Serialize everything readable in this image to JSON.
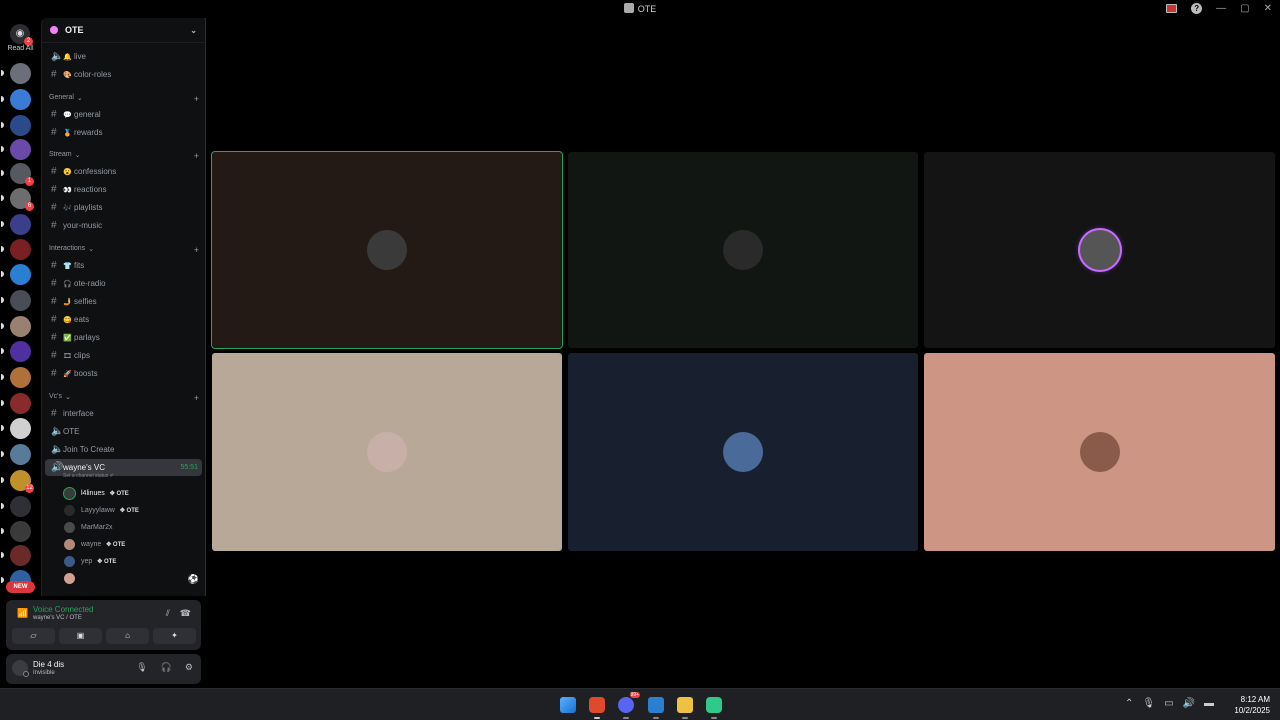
{
  "window": {
    "title": "OTE"
  },
  "rail": {
    "home_badge": "2",
    "read_all_label": "Read All",
    "new_label": "NEW",
    "servers": [
      {
        "color": "#6b6f7a",
        "badge": ""
      },
      {
        "color": "#3a7bd5",
        "badge": ""
      },
      {
        "color": "#2a4a8c",
        "badge": ""
      },
      {
        "color": "#6a4aa8",
        "badge": ""
      },
      {
        "color": "#555a60",
        "badge": "1"
      },
      {
        "color": "#6d6d70",
        "badge": "6"
      },
      {
        "color": "#3b3f8a",
        "badge": ""
      },
      {
        "color": "#7a1f24",
        "badge": ""
      },
      {
        "color": "#2a7fd0",
        "badge": ""
      },
      {
        "color": "#4a4d55",
        "badge": ""
      },
      {
        "color": "#9a8070",
        "badge": ""
      },
      {
        "color": "#5030a0",
        "badge": ""
      },
      {
        "color": "#b0703a",
        "badge": ""
      },
      {
        "color": "#8a2b2b",
        "badge": ""
      },
      {
        "color": "#d0d0d0",
        "badge": ""
      },
      {
        "color": "#5a7a9a",
        "badge": ""
      },
      {
        "color": "#c0902a",
        "badge": "12"
      },
      {
        "color": "#2e3035",
        "badge": ""
      },
      {
        "color": "#3a3a3a",
        "badge": ""
      },
      {
        "color": "#6a2a2a",
        "badge": ""
      },
      {
        "color": "#3060a0",
        "badge": ""
      }
    ]
  },
  "guild": {
    "name": "OTE"
  },
  "channels": [
    {
      "type": "voice",
      "emoji": "🔔",
      "name": "live"
    },
    {
      "type": "text",
      "emoji": "🎨",
      "name": "color-roles"
    },
    {
      "type": "category",
      "name": "General"
    },
    {
      "type": "text",
      "emoji": "💬",
      "name": "general"
    },
    {
      "type": "text",
      "emoji": "🏅",
      "name": "rewards"
    },
    {
      "type": "category",
      "name": "Stream"
    },
    {
      "type": "text",
      "emoji": "😮",
      "name": "confessions"
    },
    {
      "type": "text",
      "emoji": "👀",
      "name": "reactions"
    },
    {
      "type": "text",
      "emoji": "🎶",
      "name": "playlists"
    },
    {
      "type": "text",
      "emoji": "",
      "name": "your-music"
    },
    {
      "type": "category",
      "name": "Interactions"
    },
    {
      "type": "text",
      "emoji": "👕",
      "name": "fits"
    },
    {
      "type": "text",
      "emoji": "🎧",
      "name": "ote-radio"
    },
    {
      "type": "text",
      "emoji": "🤳",
      "name": "selfies"
    },
    {
      "type": "text",
      "emoji": "😋",
      "name": "eats"
    },
    {
      "type": "text",
      "emoji": "✅",
      "name": "parlays"
    },
    {
      "type": "text",
      "emoji": "🎞",
      "name": "clips"
    },
    {
      "type": "text",
      "emoji": "🚀",
      "name": "boosts"
    },
    {
      "type": "category",
      "name": "Vc's"
    },
    {
      "type": "text",
      "emoji": "",
      "name": "interface"
    },
    {
      "type": "voice",
      "emoji": "",
      "name": "OTE"
    },
    {
      "type": "voice",
      "emoji": "",
      "name": "Join To Create"
    },
    {
      "type": "voice-active",
      "emoji": "",
      "name": "wayne's VC",
      "time": "55:51",
      "status": "Set a channel status ✐"
    }
  ],
  "voice_users": [
    {
      "name": "l4linues",
      "tag": "✥ OTE",
      "color": "#3a3a3a",
      "speaking": true
    },
    {
      "name": "Layyylaww",
      "tag": "✥ OTE",
      "color": "#2a2a2a",
      "speaking": false
    },
    {
      "name": "MarMar2x",
      "tag": "",
      "color": "#4a4a4a",
      "speaking": false
    },
    {
      "name": "wayne",
      "tag": "✥ OTE",
      "color": "#b08a7a",
      "speaking": false
    },
    {
      "name": "yep",
      "tag": "✥ OTE",
      "color": "#3a5a8a",
      "speaking": false
    },
    {
      "name": "",
      "tag": "",
      "color": "#d0a090",
      "speaking": false
    }
  ],
  "voice_panel": {
    "status": "Voice Connected",
    "channel": "wayne's VC / OTE"
  },
  "user_panel": {
    "name": "Die 4 dis",
    "status": "Invisible"
  },
  "tiles": [
    {
      "bg": "#231a16",
      "avatar": "#3a3a3a",
      "speaking": true
    },
    {
      "bg": "#111612",
      "avatar": "#2a2a2a",
      "speaking": false
    },
    {
      "bg": "#141414",
      "avatar": "#555",
      "speaking": false,
      "ring": true
    },
    {
      "bg": "#b8a898",
      "avatar": "#c8b0a8",
      "speaking": false
    },
    {
      "bg": "#182030",
      "avatar": "#4a6a9a",
      "speaking": false
    },
    {
      "bg": "#cc9584",
      "avatar": "#8a5a4a",
      "speaking": false
    }
  ],
  "taskbar": {
    "time": "8:12 AM",
    "date": "10/2/2025",
    "discord_badge": "99+"
  }
}
